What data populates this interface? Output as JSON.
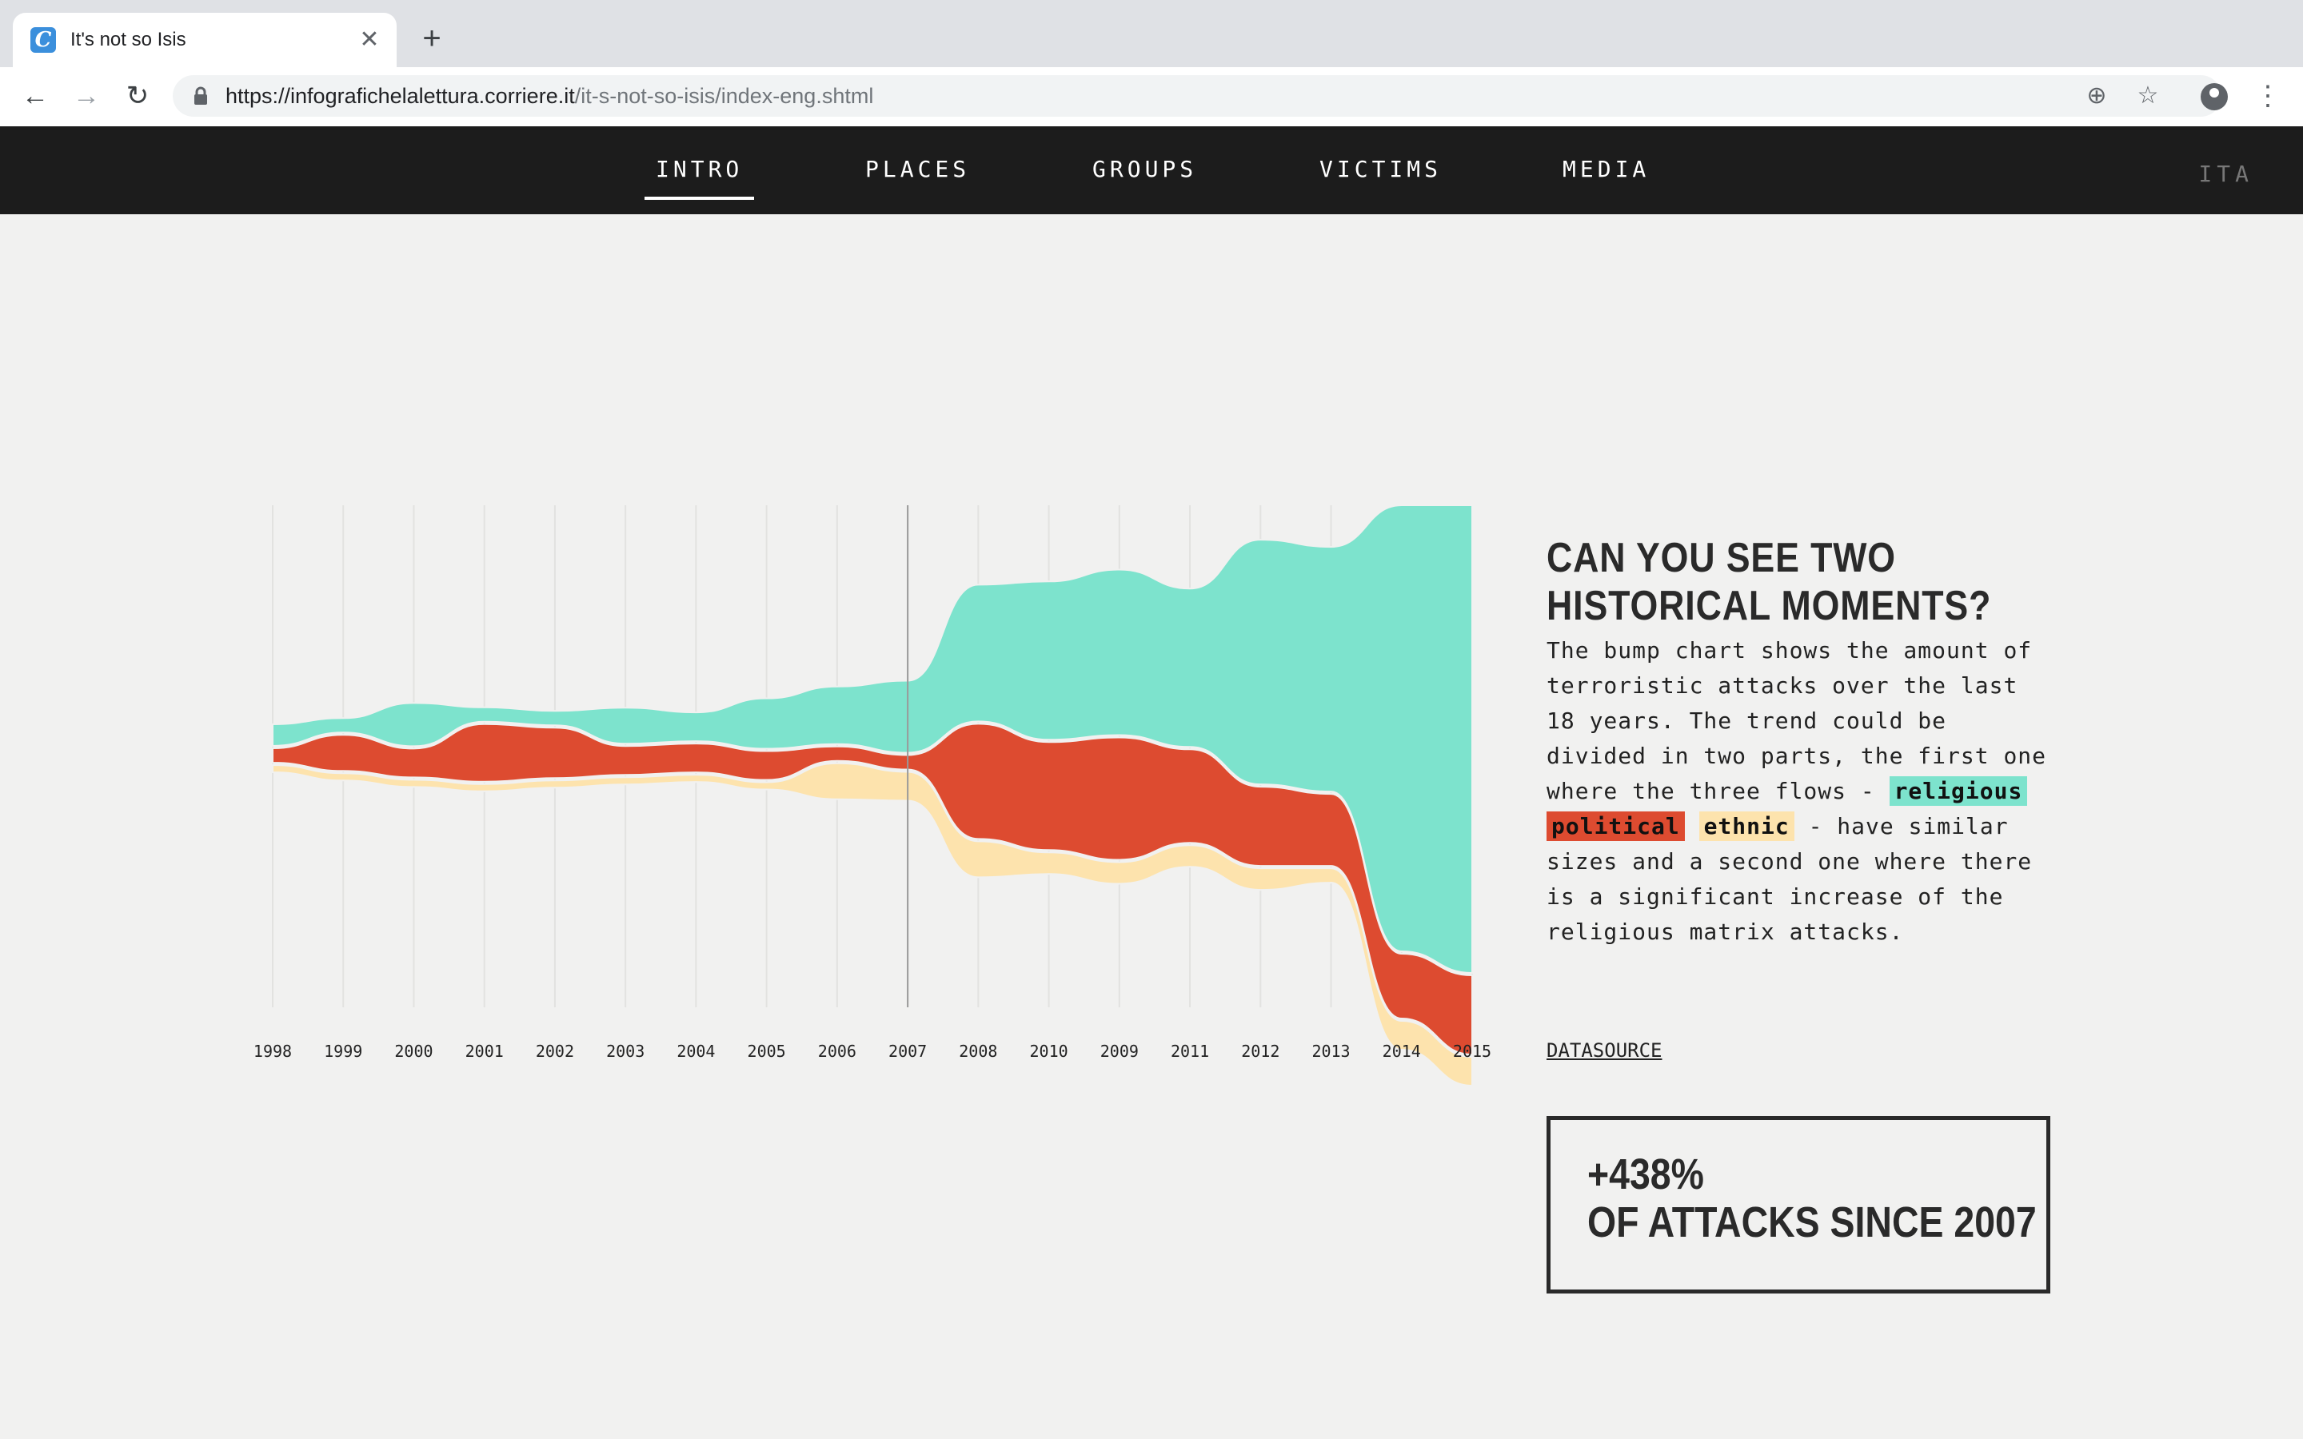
{
  "browser": {
    "tab_title": "It's not so Isis",
    "url_domain": "https://infografichelalettura.corriere.it",
    "url_path": "/it-s-not-so-isis/index-eng.shtml",
    "icons": [
      "back-icon",
      "forward-icon",
      "reload-icon",
      "lock-icon",
      "zoom-icon",
      "star-icon",
      "account-icon",
      "menu-icon"
    ]
  },
  "nav": {
    "items": [
      "INTRO",
      "PLACES",
      "GROUPS",
      "VICTIMS",
      "MEDIA"
    ],
    "active": "INTRO",
    "lang": "ITA"
  },
  "text": {
    "headline_1": "CAN YOU SEE TWO",
    "headline_2": "HISTORICAL MOMENTS?",
    "body_1": "The bump chart shows the amount of terroristic attacks over the last 18 years. The trend could be divided in two parts, the first one where the three flows - ",
    "tag_religious": "religious",
    "tag_political": "political",
    "tag_ethnic": "ethnic",
    "body_2": " - have similar sizes and a second one where there is a significant increase of the religious matrix attacks.",
    "datasource": "DATASOURCE",
    "stat_pct": "+438%",
    "stat_text": "OF ATTACKS SINCE 2007"
  },
  "chart_data": {
    "type": "area",
    "x": [
      "1998",
      "1999",
      "2000",
      "2001",
      "2002",
      "2003",
      "2004",
      "2005",
      "2006",
      "2007",
      "2008",
      "2010",
      "2009",
      "2011",
      "2012",
      "2013",
      "2014",
      "2015"
    ],
    "marker": "2007",
    "series": [
      {
        "name": "religious",
        "color": "#7de3cd",
        "values": [
          3,
          2,
          6,
          2,
          2,
          5,
          4,
          7,
          8,
          10,
          19,
          22,
          23,
          22,
          34,
          34,
          62,
          65
        ]
      },
      {
        "name": "political",
        "color": "#dd4b30",
        "values": [
          2,
          5,
          4,
          8,
          7,
          4,
          4,
          4,
          2,
          2,
          16,
          15,
          17,
          13,
          11,
          10,
          9,
          11
        ]
      },
      {
        "name": "ethnic",
        "color": "#fde3ad",
        "values": [
          1,
          1,
          1,
          1,
          1,
          1,
          1,
          1,
          5,
          4,
          5,
          3,
          3,
          3,
          3,
          2,
          4,
          4
        ]
      }
    ]
  }
}
